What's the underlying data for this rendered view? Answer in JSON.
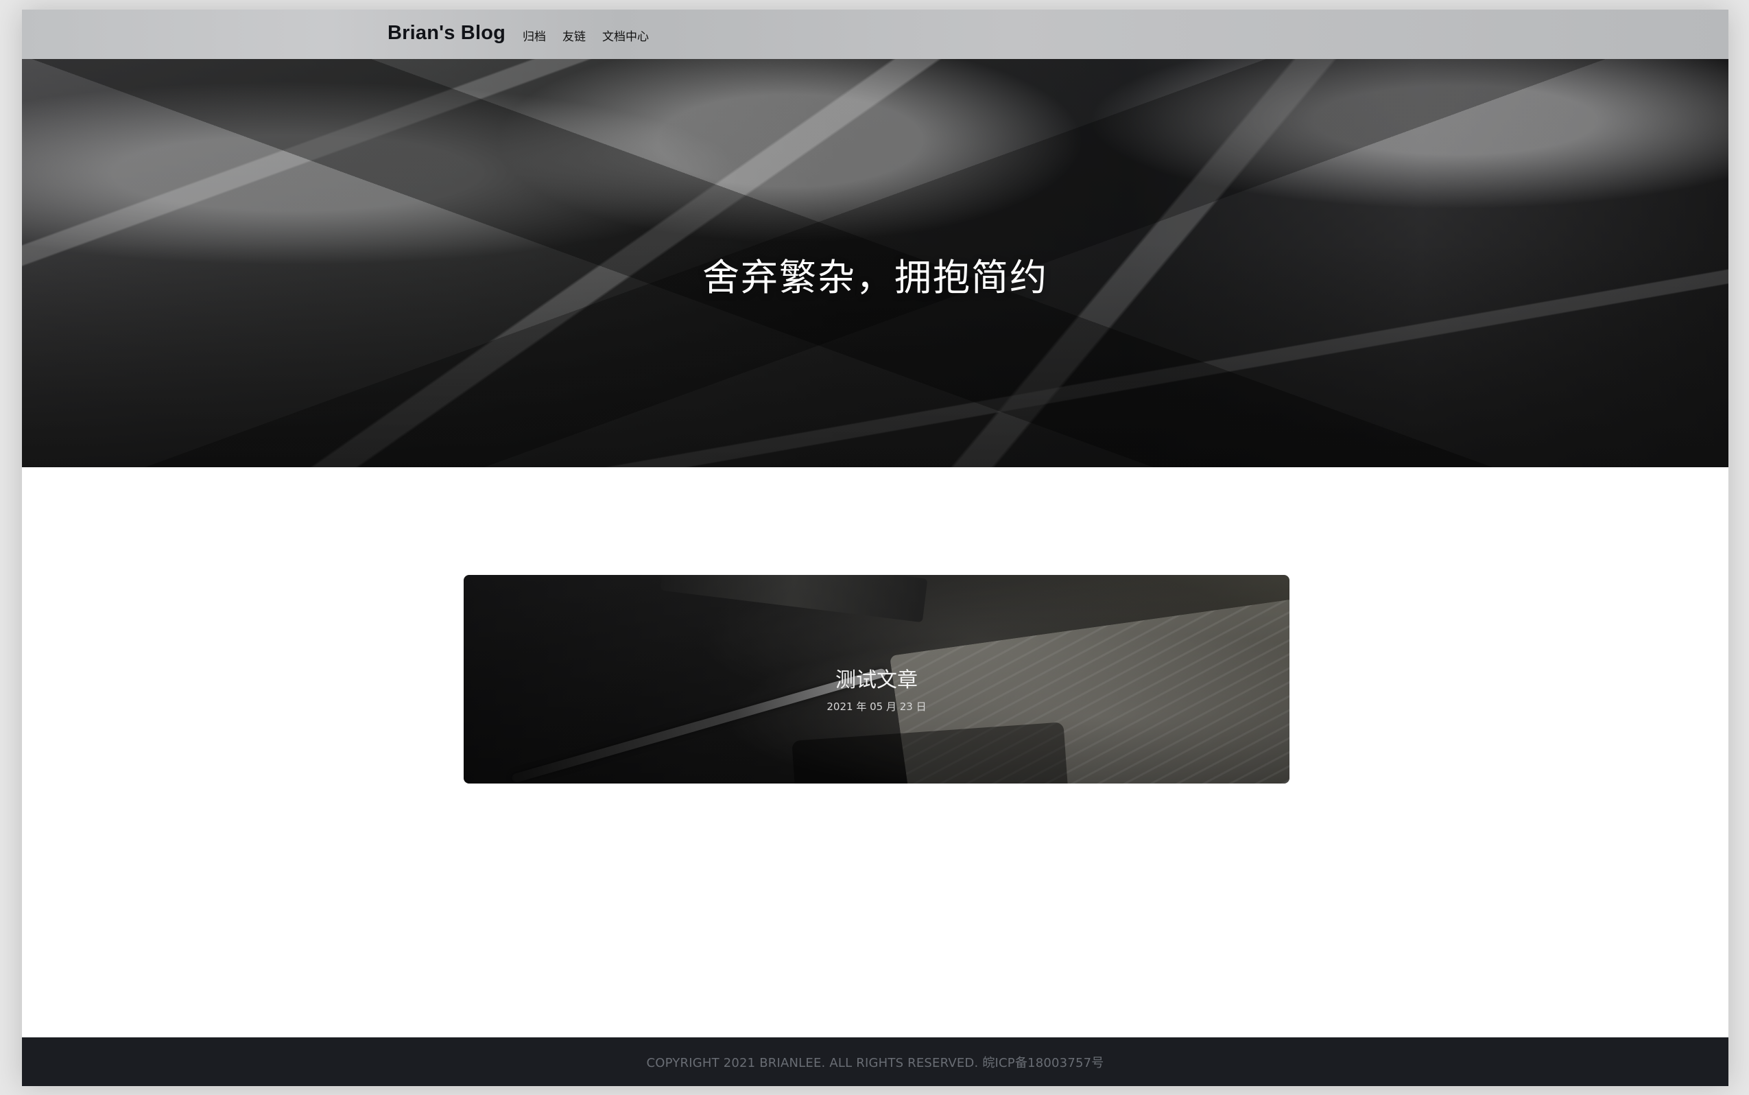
{
  "site": {
    "brand": "Brian's Blog",
    "nav": [
      {
        "label": "归档"
      },
      {
        "label": "友链"
      },
      {
        "label": "文档中心"
      }
    ]
  },
  "hero": {
    "title": "舍弃繁杂，拥抱简约"
  },
  "posts": [
    {
      "title": "测试文章",
      "date": "2021 年 05 月 23 日"
    }
  ],
  "footer": {
    "text": "COPYRIGHT 2021 BRIANLEE. ALL RIGHTS RESERVED.  皖ICP备18003757号"
  },
  "colors": {
    "page_bg": "#e7e7e7",
    "nav_bg": "#bfc1c3",
    "footer_bg": "#1b1d22",
    "footer_text": "#696d74",
    "hero_text": "#ffffff"
  }
}
